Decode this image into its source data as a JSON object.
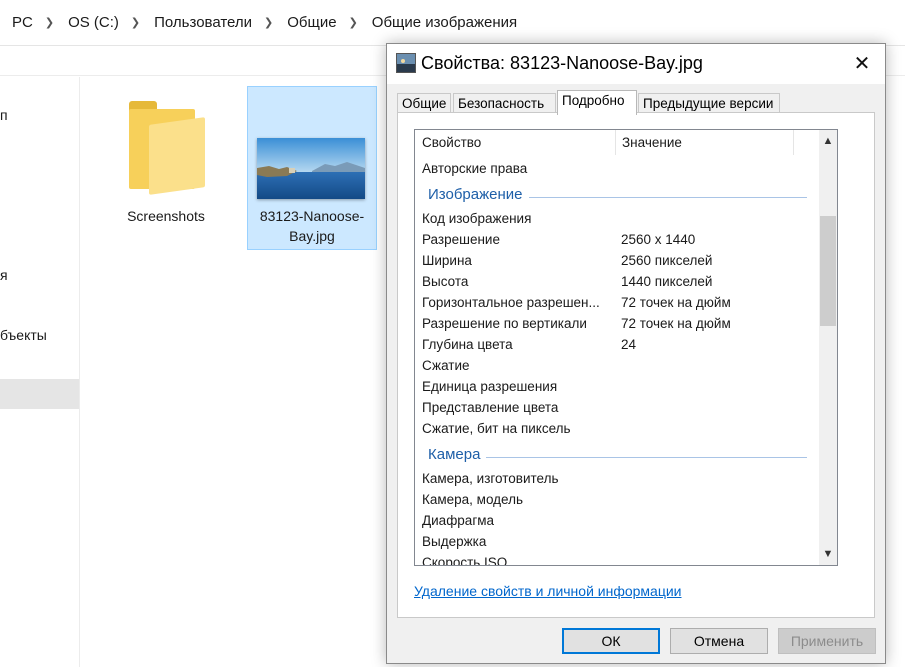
{
  "explorer": {
    "breadcrumbs": [
      "PC",
      "OS (C:)",
      "Пользователи",
      "Общие",
      "Общие изображения"
    ],
    "nav_items": [
      "п",
      "я",
      "бъекты"
    ],
    "files": [
      {
        "name": "Screenshots",
        "type": "folder"
      },
      {
        "name": "83123-Nanoose-Bay.jpg",
        "name_line1": "83123-Nanoose-",
        "name_line2": "Bay.jpg",
        "type": "image"
      }
    ]
  },
  "dialog": {
    "title": "Свойства: 83123-Nanoose-Bay.jpg",
    "close_glyph": "✕",
    "tabs": [
      "Общие",
      "Безопасность",
      "Подробно",
      "Предыдущие версии"
    ],
    "active_tab": "Подробно",
    "columns": {
      "property": "Свойство",
      "value": "Значение"
    },
    "rows_top": [
      {
        "prop": "Авторские права",
        "val": ""
      }
    ],
    "group_image": "Изображение",
    "rows_image": [
      {
        "prop": "Код изображения",
        "val": ""
      },
      {
        "prop": "Разрешение",
        "val": "2560 x 1440"
      },
      {
        "prop": "Ширина",
        "val": "2560 пикселей"
      },
      {
        "prop": "Высота",
        "val": "1440 пикселей"
      },
      {
        "prop": "Горизонтальное разрешен...",
        "val": "72 точек на дюйм"
      },
      {
        "prop": "Разрешение по вертикали",
        "val": "72 точек на дюйм"
      },
      {
        "prop": "Глубина цвета",
        "val": "24"
      },
      {
        "prop": "Сжатие",
        "val": ""
      },
      {
        "prop": "Единица разрешения",
        "val": ""
      },
      {
        "prop": "Представление цвета",
        "val": ""
      },
      {
        "prop": "Сжатие, бит на пиксель",
        "val": ""
      }
    ],
    "group_camera": "Камера",
    "rows_camera": [
      {
        "prop": "Камера, изготовитель",
        "val": ""
      },
      {
        "prop": "Камера, модель",
        "val": ""
      },
      {
        "prop": "Диафрагма",
        "val": ""
      },
      {
        "prop": "Выдержка",
        "val": ""
      },
      {
        "prop": "Скорость ISO",
        "val": ""
      }
    ],
    "remove_link": "Удаление свойств и личной информации",
    "buttons": {
      "ok": "ОК",
      "cancel": "Отмена",
      "apply": "Применить"
    },
    "colors": {
      "group_header": "#1e5fa8",
      "link": "#0066cc",
      "default_button_border": "#0078d7"
    }
  }
}
